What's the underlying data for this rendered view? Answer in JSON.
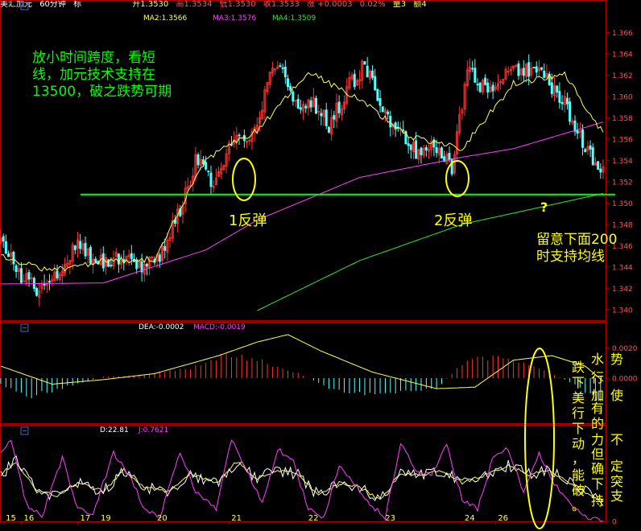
{
  "header": {
    "symbol": "美汇加元",
    "period": "60分钟",
    "mode": "标",
    "open_label": "开1.3530",
    "high_label": "高1.3534",
    "low_label": "低1.3530",
    "close_label": "收1.3533",
    "change_label": "涨 +0.0003",
    "pct_label": "0.02%",
    "vol_label": "量3",
    "amt_label": "额4"
  },
  "colors": {
    "up": "#ff3232",
    "down": "#54ffff",
    "ma_yellow": "#ffff55",
    "ma_magenta": "#ff40ff",
    "ma_green": "#32e632",
    "support_line": "#00ff00",
    "axis_red": "#b00000",
    "annotation_green": "#00ff00",
    "annotation_yellow": "#ffff00"
  },
  "chart_data": [
    {
      "type": "candlestick",
      "legend": {
        "ma2": "MA2:1.3566",
        "ma3": "MA3:1.3576",
        "ma4": "MA4:1.3509"
      },
      "ylim": [
        1.339,
        1.368
      ],
      "yticks": [
        "1.366",
        "1.364",
        "1.362",
        "1.360",
        "1.358",
        "1.356",
        "1.354",
        "1.352",
        "1.350",
        "1.348",
        "1.346",
        "1.344",
        "1.342",
        "1.340"
      ],
      "support_level": 1.3508,
      "ma_anchors": {
        "short": [
          [
            0,
            1.345
          ],
          [
            20,
            1.3436
          ],
          [
            40,
            1.3446
          ],
          [
            60,
            1.3447
          ],
          [
            80,
            1.3542
          ],
          [
            100,
            1.3568
          ],
          [
            120,
            1.3623
          ],
          [
            140,
            1.3597
          ],
          [
            160,
            1.3562
          ],
          [
            180,
            1.3551
          ],
          [
            200,
            1.3612
          ],
          [
            220,
            1.3621
          ],
          [
            235,
            1.3565
          ]
        ],
        "mid": [
          [
            0,
            1.3424
          ],
          [
            40,
            1.3425
          ],
          [
            80,
            1.3456
          ],
          [
            100,
            1.3484
          ],
          [
            140,
            1.3524
          ],
          [
            180,
            1.3543
          ],
          [
            200,
            1.3551
          ],
          [
            235,
            1.3576
          ]
        ],
        "long": [
          [
            100,
            1.3399
          ],
          [
            140,
            1.3446
          ],
          [
            180,
            1.348
          ],
          [
            235,
            1.3509
          ]
        ]
      },
      "price_path": [
        [
          0,
          1.3462
        ],
        [
          8,
          1.3432
        ],
        [
          14,
          1.342
        ],
        [
          22,
          1.3436
        ],
        [
          30,
          1.346
        ],
        [
          40,
          1.3443
        ],
        [
          48,
          1.3452
        ],
        [
          56,
          1.344
        ],
        [
          62,
          1.3452
        ],
        [
          70,
          1.3492
        ],
        [
          76,
          1.3538
        ],
        [
          84,
          1.3518
        ],
        [
          90,
          1.3555
        ],
        [
          100,
          1.3566
        ],
        [
          104,
          1.3615
        ],
        [
          110,
          1.363
        ],
        [
          116,
          1.3585
        ],
        [
          122,
          1.3595
        ],
        [
          128,
          1.3572
        ],
        [
          136,
          1.361
        ],
        [
          142,
          1.363
        ],
        [
          148,
          1.359
        ],
        [
          156,
          1.3568
        ],
        [
          162,
          1.3548
        ],
        [
          168,
          1.356
        ],
        [
          172,
          1.3548
        ],
        [
          176,
          1.3534
        ],
        [
          182,
          1.3622
        ],
        [
          190,
          1.3605
        ],
        [
          196,
          1.3622
        ],
        [
          204,
          1.3625
        ],
        [
          212,
          1.3618
        ],
        [
          220,
          1.3595
        ],
        [
          226,
          1.356
        ],
        [
          232,
          1.354
        ],
        [
          235,
          1.3533
        ]
      ]
    },
    {
      "type": "macd",
      "legend": {
        "dea": "DEA:-0.0002",
        "macd": "MACD:-0.0019"
      },
      "ylim": [
        -0.003,
        0.003
      ],
      "yticks": [
        "0.0020",
        "0.0000"
      ],
      "hist_anchors": [
        [
          0,
          -0.0004
        ],
        [
          10,
          -0.0013
        ],
        [
          25,
          -0.0006
        ],
        [
          40,
          0.0001
        ],
        [
          55,
          0.0002
        ],
        [
          75,
          0.0007
        ],
        [
          88,
          0.0016
        ],
        [
          100,
          0.0012
        ],
        [
          115,
          0.0004
        ],
        [
          130,
          -0.0008
        ],
        [
          145,
          -0.0011
        ],
        [
          160,
          -0.0009
        ],
        [
          170,
          -0.0007
        ],
        [
          182,
          0.0013
        ],
        [
          195,
          0.0014
        ],
        [
          205,
          0.0009
        ],
        [
          215,
          0.0003
        ],
        [
          225,
          -0.0005
        ],
        [
          235,
          -0.0019
        ]
      ],
      "dea_anchors": [
        [
          0,
          0.0008
        ],
        [
          20,
          -0.0004
        ],
        [
          40,
          -0.0001
        ],
        [
          60,
          0.0003
        ],
        [
          85,
          0.0015
        ],
        [
          100,
          0.0024
        ],
        [
          112,
          0.0029
        ],
        [
          125,
          0.0018
        ],
        [
          145,
          0.0004
        ],
        [
          170,
          -0.0007
        ],
        [
          185,
          -0.0006
        ],
        [
          200,
          0.0012
        ],
        [
          215,
          0.0015
        ],
        [
          228,
          0.0008
        ],
        [
          235,
          -0.0002
        ]
      ]
    },
    {
      "type": "kdj",
      "legend": {
        "d": "D:22.81",
        "j": "J:0.7621"
      },
      "ylim": [
        0,
        100
      ],
      "yticks": [
        "0"
      ],
      "xticks": [
        {
          "i": 1,
          "label": "15"
        },
        {
          "i": 8,
          "label": "16"
        },
        {
          "i": 30,
          "label": "17"
        },
        {
          "i": 38,
          "label": "19"
        },
        {
          "i": 60,
          "label": "20"
        },
        {
          "i": 89,
          "label": "21"
        },
        {
          "i": 119,
          "label": "22"
        },
        {
          "i": 149,
          "label": "23"
        },
        {
          "i": 180,
          "label": "24"
        },
        {
          "i": 193,
          "label": "26"
        }
      ],
      "j_anchors": [
        [
          0,
          80
        ],
        [
          4,
          95
        ],
        [
          10,
          20
        ],
        [
          16,
          5
        ],
        [
          24,
          75
        ],
        [
          30,
          15
        ],
        [
          36,
          10
        ],
        [
          44,
          80
        ],
        [
          50,
          55
        ],
        [
          56,
          15
        ],
        [
          62,
          5
        ],
        [
          70,
          80
        ],
        [
          76,
          35
        ],
        [
          84,
          15
        ],
        [
          90,
          95
        ],
        [
          96,
          60
        ],
        [
          102,
          20
        ],
        [
          108,
          85
        ],
        [
          114,
          70
        ],
        [
          120,
          15
        ],
        [
          126,
          5
        ],
        [
          132,
          65
        ],
        [
          138,
          45
        ],
        [
          144,
          20
        ],
        [
          150,
          5
        ],
        [
          156,
          90
        ],
        [
          162,
          60
        ],
        [
          168,
          55
        ],
        [
          174,
          90
        ],
        [
          180,
          25
        ],
        [
          186,
          15
        ],
        [
          192,
          75
        ],
        [
          198,
          85
        ],
        [
          204,
          35
        ],
        [
          210,
          80
        ],
        [
          216,
          45
        ],
        [
          222,
          20
        ],
        [
          228,
          5
        ],
        [
          235,
          0.7621
        ]
      ],
      "d_anchors": [
        [
          0,
          55
        ],
        [
          6,
          70
        ],
        [
          14,
          35
        ],
        [
          22,
          30
        ],
        [
          30,
          45
        ],
        [
          40,
          35
        ],
        [
          48,
          60
        ],
        [
          56,
          40
        ],
        [
          66,
          35
        ],
        [
          74,
          55
        ],
        [
          84,
          45
        ],
        [
          92,
          70
        ],
        [
          100,
          50
        ],
        [
          108,
          60
        ],
        [
          116,
          55
        ],
        [
          124,
          30
        ],
        [
          132,
          45
        ],
        [
          140,
          40
        ],
        [
          148,
          25
        ],
        [
          156,
          55
        ],
        [
          164,
          55
        ],
        [
          172,
          60
        ],
        [
          180,
          45
        ],
        [
          190,
          55
        ],
        [
          198,
          65
        ],
        [
          206,
          55
        ],
        [
          214,
          60
        ],
        [
          222,
          45
        ],
        [
          235,
          22.81
        ]
      ]
    }
  ],
  "annotations": {
    "note_top_line1": "放小时间跨度，看短",
    "note_top_line2": "线，加元技术支持在",
    "note_top_line3": "13500，破之跌势可期",
    "rebound1": "1反弹",
    "rebound2": "2反弹",
    "question": "?",
    "ma200_line1": "留意下面200",
    "ma200_line2": "时支持均线",
    "vertical_note": [
      "跌",
      "水",
      "势",
      "下",
      "行",
      ",",
      "美",
      "加",
      "使",
      "行",
      "有",
      "下",
      "的",
      "动",
      "力",
      "不",
      "但",
      "，",
      "确",
      "定",
      "能",
      "突",
      "支",
      "下",
      "破",
      "持",
      "。"
    ]
  }
}
